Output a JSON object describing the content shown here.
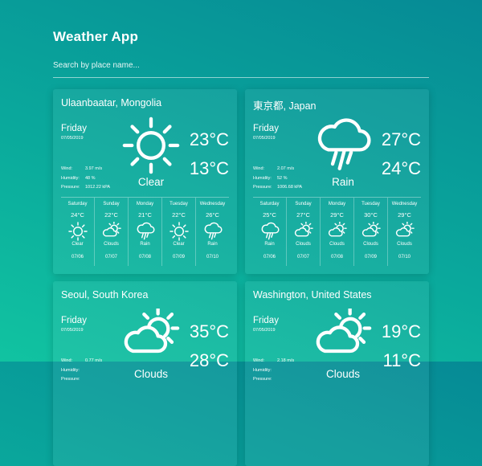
{
  "app": {
    "title": "Weather App"
  },
  "search": {
    "placeholder": "Search by place name..."
  },
  "labels": {
    "wind": "Wind:",
    "humidity": "Humidity:",
    "pressure": "Pressure:"
  },
  "cards": [
    {
      "city": "Ulaanbaatar, Mongolia",
      "day": "Friday",
      "date": "07/05/2019",
      "temp_high": "23°C",
      "temp_low": "13°C",
      "condition": "Clear",
      "icon": "sun-icon",
      "wind": "3.97 m/s",
      "humidity": "48 %",
      "pressure": "1012.22 kPA",
      "forecast": [
        {
          "day": "Saturday",
          "temp": "24°C",
          "icon": "sun-icon",
          "cond": "Clear",
          "date": "07/06"
        },
        {
          "day": "Sunday",
          "temp": "22°C",
          "icon": "cloud-sun-icon",
          "cond": "Clouds",
          "date": "07/07"
        },
        {
          "day": "Monday",
          "temp": "21°C",
          "icon": "rain-icon",
          "cond": "Rain",
          "date": "07/08"
        },
        {
          "day": "Tuesday",
          "temp": "22°C",
          "icon": "sun-icon",
          "cond": "Clear",
          "date": "07/09"
        },
        {
          "day": "Wednesday",
          "temp": "26°C",
          "icon": "rain-icon",
          "cond": "Rain",
          "date": "07/10"
        }
      ]
    },
    {
      "city": "東京都, Japan",
      "day": "Friday",
      "date": "07/05/2019",
      "temp_high": "27°C",
      "temp_low": "24°C",
      "condition": "Rain",
      "icon": "rain-icon",
      "wind": "2.07 m/s",
      "humidity": "52 %",
      "pressure": "1006.68 kPA",
      "forecast": [
        {
          "day": "Saturday",
          "temp": "25°C",
          "icon": "rain-icon",
          "cond": "Rain",
          "date": "07/06"
        },
        {
          "day": "Sunday",
          "temp": "27°C",
          "icon": "cloud-sun-icon",
          "cond": "Clouds",
          "date": "07/07"
        },
        {
          "day": "Monday",
          "temp": "29°C",
          "icon": "cloud-sun-icon",
          "cond": "Clouds",
          "date": "07/08"
        },
        {
          "day": "Tuesday",
          "temp": "30°C",
          "icon": "cloud-sun-icon",
          "cond": "Clouds",
          "date": "07/09"
        },
        {
          "day": "Wednesday",
          "temp": "29°C",
          "icon": "cloud-sun-icon",
          "cond": "Clouds",
          "date": "07/10"
        }
      ]
    },
    {
      "city": "Seoul, South Korea",
      "day": "Friday",
      "date": "07/05/2019",
      "temp_high": "35°C",
      "temp_low": "28°C",
      "condition": "Clouds",
      "icon": "cloud-sun-icon",
      "wind": "0.77 m/s",
      "humidity": "",
      "pressure": "",
      "forecast": []
    },
    {
      "city": "Washington, United States",
      "day": "Friday",
      "date": "07/05/2019",
      "temp_high": "19°C",
      "temp_low": "11°C",
      "condition": "Clouds",
      "icon": "cloud-sun-icon",
      "wind": "2.18 m/s",
      "humidity": "",
      "pressure": "",
      "forecast": []
    }
  ]
}
